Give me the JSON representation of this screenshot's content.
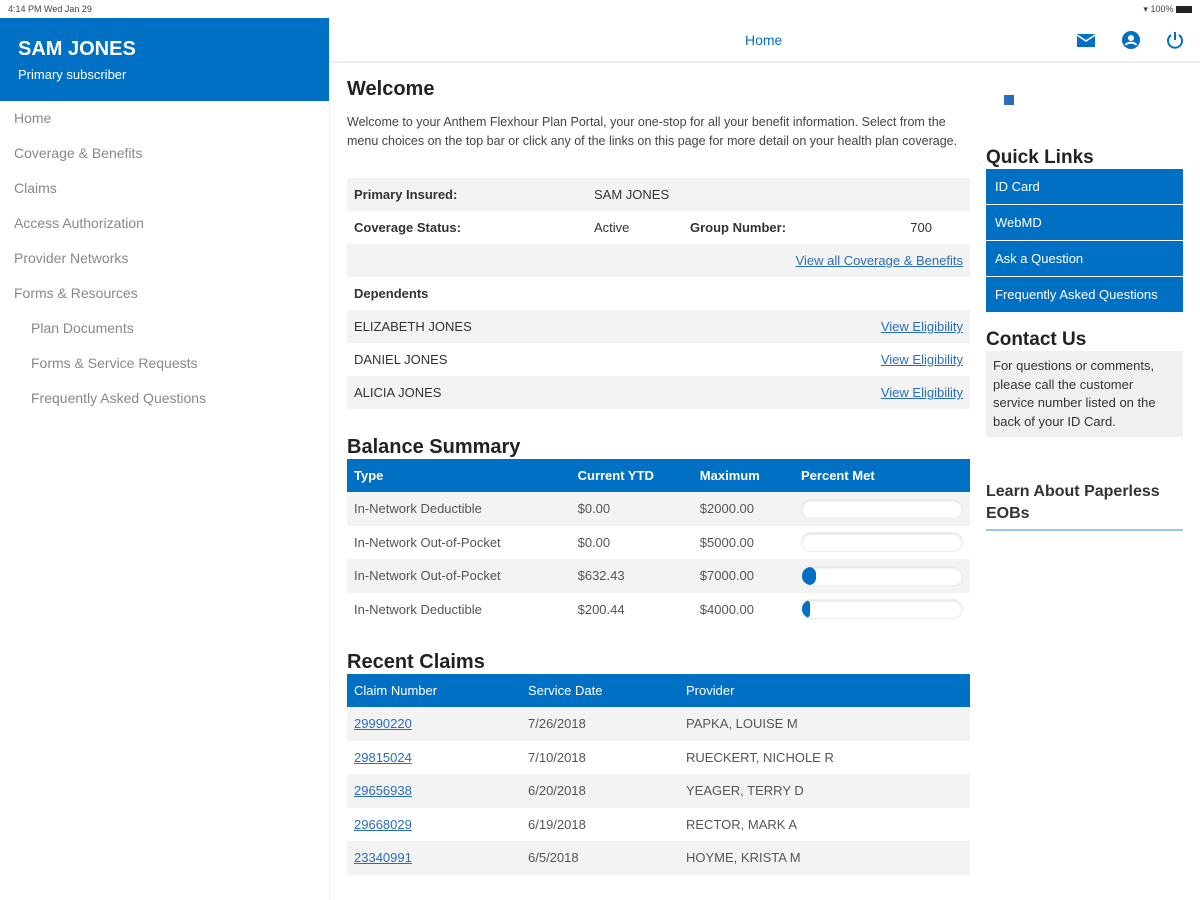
{
  "status_bar": {
    "time": "4:14 PM  Wed Jan 29",
    "battery": "100%"
  },
  "user": {
    "name": "SAM JONES",
    "role": "Primary subscriber"
  },
  "sidebar": {
    "items": [
      {
        "label": "Home"
      },
      {
        "label": "Coverage & Benefits"
      },
      {
        "label": "Claims"
      },
      {
        "label": "Access Authorization"
      },
      {
        "label": "Provider Networks"
      },
      {
        "label": "Forms & Resources"
      },
      {
        "label": "Plan Documents",
        "sub": true
      },
      {
        "label": "Forms & Service Requests",
        "sub": true
      },
      {
        "label": "Frequently Asked Questions",
        "sub": true
      }
    ]
  },
  "header": {
    "title": "Home",
    "icons": [
      "mail-icon",
      "user-icon",
      "power-icon"
    ]
  },
  "welcome": {
    "title": "Welcome",
    "text": "Welcome to your Anthem Flexhour Plan Portal, your one-stop for all your benefit information. Select from the menu choices on the top bar or click any of the links on this page for more detail on your health plan coverage."
  },
  "coverage": {
    "primary_label": "Primary Insured:",
    "primary_value": "SAM JONES",
    "status_label": "Coverage Status:",
    "status_value": "Active",
    "group_label": "Group Number:",
    "group_value": "700",
    "view_all": "View all Coverage & Benefits",
    "dependents_label": "Dependents",
    "dependents": [
      {
        "name": "ELIZABETH JONES",
        "link": "View Eligibility"
      },
      {
        "name": "DANIEL JONES",
        "link": "View Eligibility"
      },
      {
        "name": "ALICIA JONES",
        "link": "View Eligibility"
      }
    ]
  },
  "balance": {
    "title": "Balance Summary",
    "headers": [
      "Type",
      "Current YTD",
      "Maximum",
      "Percent Met"
    ],
    "rows": [
      {
        "type": "In-Network Deductible",
        "ytd": "$0.00",
        "max": "$2000.00",
        "percent": 0
      },
      {
        "type": "In-Network Out-of-Pocket",
        "ytd": "$0.00",
        "max": "$5000.00",
        "percent": 0
      },
      {
        "type": "In-Network Out-of-Pocket",
        "ytd": "$632.43",
        "max": "$7000.00",
        "percent": 9
      },
      {
        "type": "In-Network Deductible",
        "ytd": "$200.44",
        "max": "$4000.00",
        "percent": 5
      }
    ]
  },
  "claims": {
    "title": "Recent Claims",
    "headers": [
      "Claim Number",
      "Service Date",
      "Provider"
    ],
    "rows": [
      {
        "num": "29990220",
        "date": "7/26/2018",
        "provider": "PAPKA, LOUISE M"
      },
      {
        "num": "29815024",
        "date": "7/10/2018",
        "provider": "RUECKERT, NICHOLE R"
      },
      {
        "num": "29656938",
        "date": "6/20/2018",
        "provider": "YEAGER, TERRY D"
      },
      {
        "num": "29668029",
        "date": "6/19/2018",
        "provider": "RECTOR, MARK A"
      },
      {
        "num": "23340991",
        "date": "6/5/2018",
        "provider": "HOYME, KRISTA M"
      }
    ]
  },
  "quick_links": {
    "title": "Quick Links",
    "items": [
      "ID Card",
      "WebMD",
      "Ask a Question",
      "Frequently Asked Questions"
    ]
  },
  "contact": {
    "title": "Contact Us",
    "text": "For questions or comments, please call the customer service number listed on the back of your ID Card."
  },
  "paperless": {
    "title": "Learn About Paperless EOBs"
  },
  "colors": {
    "brand": "#0070c4",
    "link": "#2a6ebb"
  }
}
